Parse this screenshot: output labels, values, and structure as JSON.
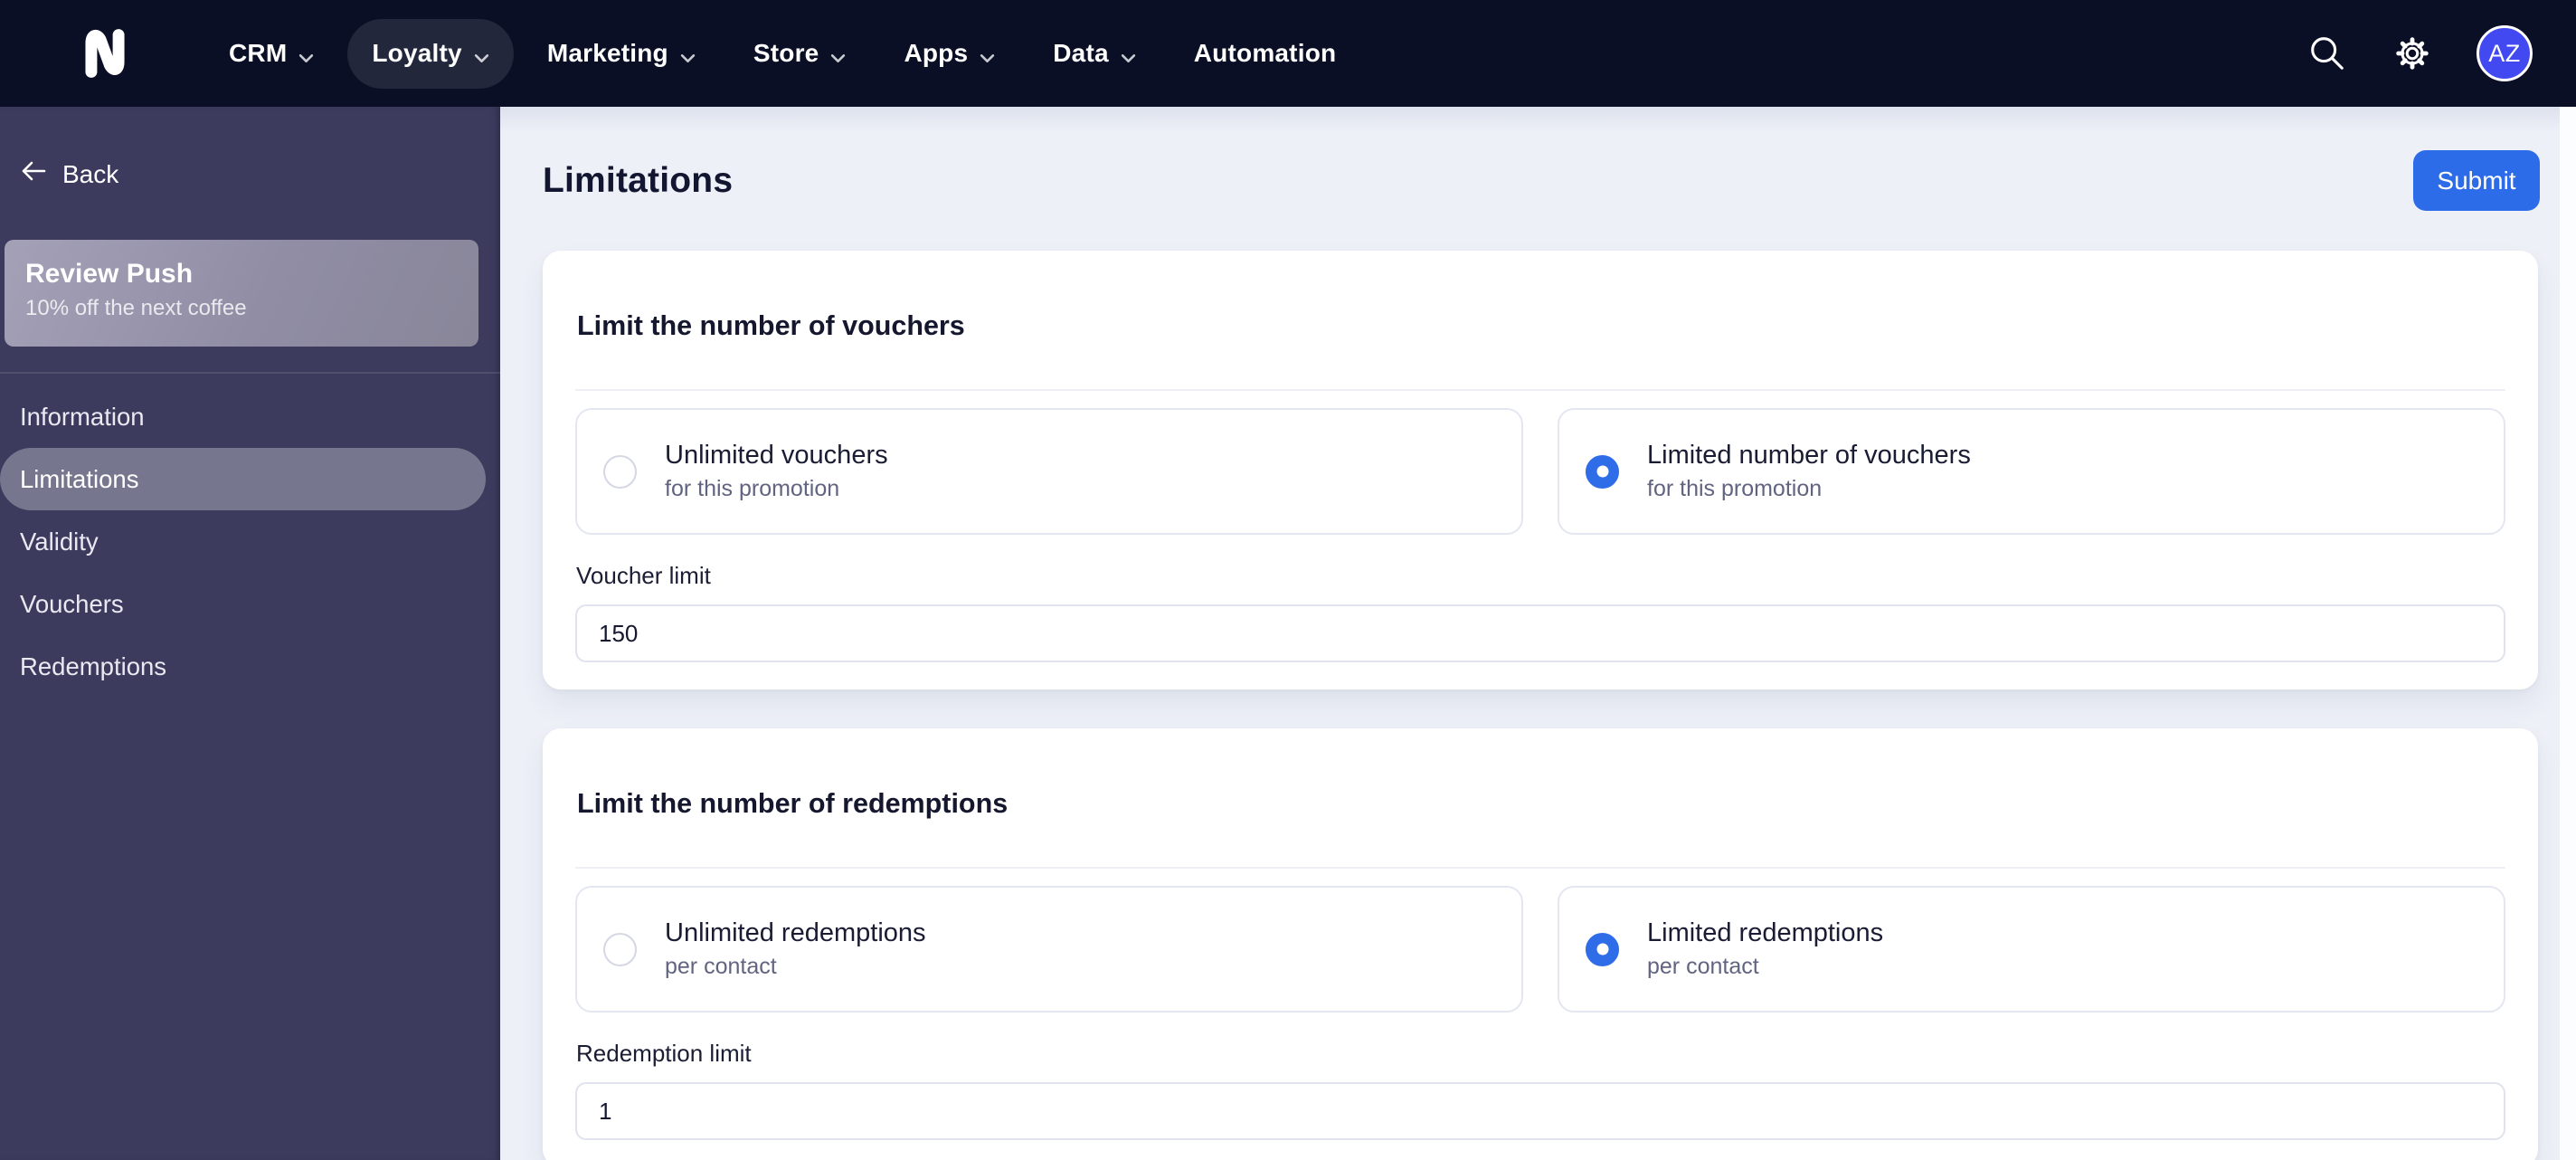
{
  "nav": {
    "items": [
      {
        "label": "CRM",
        "has_chevron": true,
        "active": false
      },
      {
        "label": "Loyalty",
        "has_chevron": true,
        "active": true
      },
      {
        "label": "Marketing",
        "has_chevron": true,
        "active": false
      },
      {
        "label": "Store",
        "has_chevron": true,
        "active": false
      },
      {
        "label": "Apps",
        "has_chevron": true,
        "active": false
      },
      {
        "label": "Data",
        "has_chevron": true,
        "active": false
      },
      {
        "label": "Automation",
        "has_chevron": false,
        "active": false
      }
    ],
    "icons": [
      "brand-n-logo",
      "search-icon",
      "gear-icon"
    ],
    "avatar_initials": "AZ"
  },
  "sidebar": {
    "back_label": "Back",
    "back_icon": "arrow-left-icon",
    "promo_card": {
      "title": "Review Push",
      "subtitle": "10% off the next coffee"
    },
    "items": [
      {
        "label": "Information",
        "active": false
      },
      {
        "label": "Limitations",
        "active": true
      },
      {
        "label": "Validity",
        "active": false
      },
      {
        "label": "Vouchers",
        "active": false
      },
      {
        "label": "Redemptions",
        "active": false
      }
    ]
  },
  "main": {
    "title": "Limitations",
    "submit_label": "Submit",
    "sections": [
      {
        "heading": "Limit the number of vouchers",
        "options": [
          {
            "title": "Unlimited vouchers",
            "subtitle": "for this promotion",
            "selected": false
          },
          {
            "title": "Limited number of vouchers",
            "subtitle": "for this promotion",
            "selected": true
          }
        ],
        "field": {
          "label": "Voucher limit",
          "value": "150"
        }
      },
      {
        "heading": "Limit the number of redemptions",
        "options": [
          {
            "title": "Unlimited redemptions",
            "subtitle": "per contact",
            "selected": false
          },
          {
            "title": "Limited redemptions",
            "subtitle": "per contact",
            "selected": true
          }
        ],
        "field": {
          "label": "Redemption limit",
          "value": "1"
        }
      }
    ]
  },
  "colors": {
    "header_bg": "#0a0f26",
    "sidebar_bg": "#3c3b5e",
    "page_bg": "#edf0f7",
    "accent_blue": "#2d6ce9",
    "avatar_bg": "#4349f0",
    "radio_selected": "#2e6ce8"
  }
}
